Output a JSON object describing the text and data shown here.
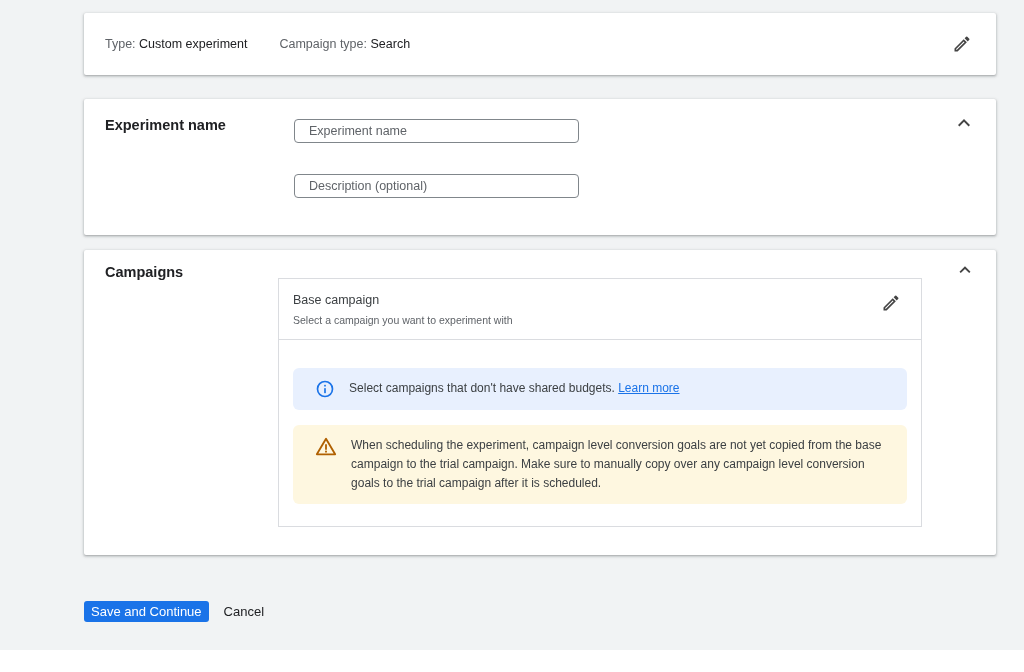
{
  "summary": {
    "items": [
      {
        "label": "Type:",
        "value": "Custom experiment"
      },
      {
        "label": "Campaign type:",
        "value": "Search"
      }
    ]
  },
  "name_section": {
    "title": "Experiment name",
    "expanded": true,
    "fields": [
      {
        "placeholder": "Experiment name"
      },
      {
        "placeholder": "Description (optional)"
      }
    ]
  },
  "campaigns_section": {
    "title": "Campaigns",
    "expanded": true,
    "base_campaign": {
      "title": "Base campaign",
      "subtitle": "Select a campaign you want to experiment with"
    },
    "notices": [
      {
        "kind": "info",
        "text": "Select campaigns that don't have shared budgets.",
        "link": "Learn more"
      },
      {
        "kind": "warning",
        "text": "When scheduling the experiment, campaign level conversion goals are not yet copied from the base campaign to the trial campaign. Make sure to manually copy over any campaign level conversion goals to the trial campaign after it is scheduled."
      }
    ]
  },
  "buttons": [
    {
      "kind": "primary",
      "label": "Save and Continue"
    },
    {
      "kind": "text",
      "label": "Cancel"
    }
  ]
}
